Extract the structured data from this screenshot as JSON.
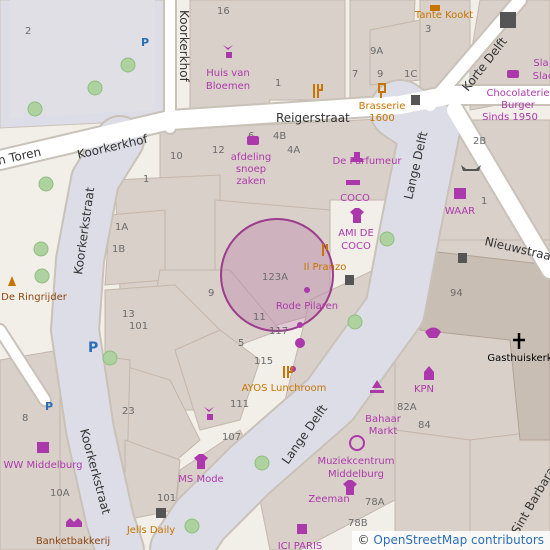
{
  "streets": {
    "reigerstraat": "Reigerstraat",
    "koorkerkhof": "Koorkerkhof",
    "koorkerkstraat": "Koorkerkstraat",
    "lange_delft": "Lange Delft",
    "lange_delft_2": "Lange Delft",
    "korte_delft": "Korte Delft",
    "nieuwstraat": "Nieuwstraat",
    "van_toren": "en Toren",
    "koorkerkhof_v": "Koorkerkhof",
    "gasthuiskerk_street": "Sint Barbara"
  },
  "pois": {
    "huis_van_bloemen": [
      "Huis van",
      "Bloemen"
    ],
    "brasserie": [
      "Brasserie",
      "1600"
    ],
    "tante_kookt": "Tante Kookt",
    "chocolaterie": [
      "Chocolaterie",
      "Burger",
      "Sinds 1950"
    ],
    "afdeling": [
      "afdeling",
      "snoep",
      "zaken"
    ],
    "de_parfumeur": "De Parfumeur",
    "coco": "COCO",
    "ami_de_coco": [
      "AMI DE",
      "COCO"
    ],
    "il_pranzo": "Il Pranzo",
    "waar": "WAAR",
    "de_ringrijder": "De Ringrijder",
    "rode_pilaren": "Rode Pilaren",
    "ayos": "AYOS Lunchroom",
    "kpn": "KPN",
    "bahaar": [
      "Bahaar",
      "Markt"
    ],
    "muziekcentrum": [
      "Muziekcentrum",
      "Middelburg"
    ],
    "zeeman": "Zeeman",
    "ms_mode": "MS Mode",
    "ww_middelburg": "WW Middelburg",
    "jells_daily": "Jells Daily",
    "banketbakkerij": "Banketbakkerij",
    "ici_paris": "ICI PARIS",
    "gasthuiskerk": "Gasthuiskerk",
    "sla": "Sla",
    "slac": "Slac"
  },
  "house_numbers": {
    "n16": "16",
    "n2": "2",
    "n9A": "9A",
    "n3": "3",
    "n1C": "1C",
    "n9": "9",
    "n7": "7",
    "n1": "1",
    "n6": "6",
    "n4B": "4B",
    "n4A": "4A",
    "n12": "12",
    "n10": "10",
    "n1b": "1",
    "n2B": "2B",
    "n1c": "1",
    "n1A": "1A",
    "n1B": "1B",
    "n123A": "123A",
    "n9b": "9",
    "n13": "13",
    "n11": "11",
    "n117": "117",
    "n5": "5",
    "n115": "115",
    "n101": "101",
    "n111": "111",
    "n23": "23",
    "n107": "107",
    "n94": "94",
    "n82A": "82A",
    "n84": "84",
    "n8": "8",
    "n10A": "10A",
    "n78A": "78A",
    "n78B": "78B",
    "n101b": "101"
  },
  "attribution": {
    "copyright": "©",
    "link_text": "OpenStreetMap contributors"
  },
  "colors": {
    "background": "#f2efe9",
    "building": "#d9d0c9",
    "building_outline": "#c4b6ab",
    "road": "#ffffff",
    "road_outline": "#c9c2b8",
    "pedestrian": "#dddde8",
    "church": "#c9beb4",
    "poi": "#ac39ac",
    "food": "#c77400",
    "highlight_circle": "#9c3c8c"
  }
}
